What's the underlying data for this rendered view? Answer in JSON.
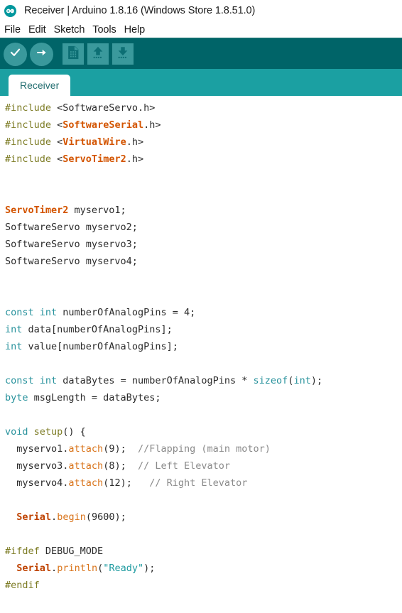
{
  "window": {
    "logo_icon": "arduino-infinity-icon",
    "title": "Receiver | Arduino 1.8.16 (Windows Store 1.8.51.0)"
  },
  "menubar": {
    "items": [
      {
        "label": "File"
      },
      {
        "label": "Edit"
      },
      {
        "label": "Sketch"
      },
      {
        "label": "Tools"
      },
      {
        "label": "Help"
      }
    ]
  },
  "toolbar": {
    "buttons": [
      {
        "name": "verify-button",
        "icon": "checkmark-icon",
        "label": "Verify"
      },
      {
        "name": "upload-button",
        "icon": "right-arrow-icon",
        "label": "Upload"
      },
      {
        "name": "new-button",
        "icon": "new-document-icon",
        "label": "New"
      },
      {
        "name": "open-button",
        "icon": "up-arrow-icon",
        "label": "Open"
      },
      {
        "name": "save-button",
        "icon": "down-arrow-icon",
        "label": "Save"
      }
    ]
  },
  "tabs": [
    {
      "label": "Receiver",
      "active": true
    }
  ],
  "colors": {
    "toolbar_bg": "#006468",
    "tabbar_bg": "#1ba0a2",
    "tab_button_bg": "#3a999c",
    "tab_text": "#236e70",
    "editor_bg": "#ffffff",
    "preprocessor": "#7d7c25",
    "keyword": "#28929c",
    "library": "#d35400",
    "object": "#bf4302",
    "method": "#d9741b",
    "string": "#1f9ba0",
    "comment": "#8a8a8a",
    "plain_text": "#2b2b2b"
  },
  "editor": {
    "lines": [
      [
        {
          "t": "#include ",
          "c": "t-pre"
        },
        {
          "t": "<SoftwareServo.h>",
          "c": "t-plain"
        }
      ],
      [
        {
          "t": "#include ",
          "c": "t-pre"
        },
        {
          "t": "<",
          "c": "t-plain"
        },
        {
          "t": "SoftwareSerial",
          "c": "t-lib"
        },
        {
          "t": ".h>",
          "c": "t-plain"
        }
      ],
      [
        {
          "t": "#include ",
          "c": "t-pre"
        },
        {
          "t": "<",
          "c": "t-plain"
        },
        {
          "t": "VirtualWire",
          "c": "t-lib"
        },
        {
          "t": ".h>",
          "c": "t-plain"
        }
      ],
      [
        {
          "t": "#include ",
          "c": "t-pre"
        },
        {
          "t": "<",
          "c": "t-plain"
        },
        {
          "t": "ServoTimer2",
          "c": "t-lib"
        },
        {
          "t": ".h>",
          "c": "t-plain"
        }
      ],
      [],
      [],
      [
        {
          "t": "ServoTimer2",
          "c": "t-lib"
        },
        {
          "t": " myservo1;",
          "c": "t-plain"
        }
      ],
      [
        {
          "t": "SoftwareServo myservo2;",
          "c": "t-plain"
        }
      ],
      [
        {
          "t": "SoftwareServo myservo3;",
          "c": "t-plain"
        }
      ],
      [
        {
          "t": "SoftwareServo myservo4;",
          "c": "t-plain"
        }
      ],
      [],
      [],
      [
        {
          "t": "const",
          "c": "t-kw"
        },
        {
          "t": " ",
          "c": "t-plain"
        },
        {
          "t": "int",
          "c": "t-kw"
        },
        {
          "t": " numberOfAnalogPins = 4;",
          "c": "t-plain"
        }
      ],
      [
        {
          "t": "int",
          "c": "t-kw"
        },
        {
          "t": " data[numberOfAnalogPins];",
          "c": "t-plain"
        }
      ],
      [
        {
          "t": "int",
          "c": "t-kw"
        },
        {
          "t": " value[numberOfAnalogPins];",
          "c": "t-plain"
        }
      ],
      [],
      [
        {
          "t": "const",
          "c": "t-kw"
        },
        {
          "t": " ",
          "c": "t-plain"
        },
        {
          "t": "int",
          "c": "t-kw"
        },
        {
          "t": " dataBytes = numberOfAnalogPins * ",
          "c": "t-plain"
        },
        {
          "t": "sizeof",
          "c": "t-kw"
        },
        {
          "t": "(",
          "c": "t-plain"
        },
        {
          "t": "int",
          "c": "t-kw"
        },
        {
          "t": ");",
          "c": "t-plain"
        }
      ],
      [
        {
          "t": "byte",
          "c": "t-kw"
        },
        {
          "t": " msgLength = dataBytes;",
          "c": "t-plain"
        }
      ],
      [],
      [
        {
          "t": "void",
          "c": "t-kw"
        },
        {
          "t": " ",
          "c": "t-plain"
        },
        {
          "t": "setup",
          "c": "t-func"
        },
        {
          "t": "() {",
          "c": "t-plain"
        }
      ],
      [
        {
          "t": "  myservo1.",
          "c": "t-plain"
        },
        {
          "t": "attach",
          "c": "t-method"
        },
        {
          "t": "(9);  ",
          "c": "t-plain"
        },
        {
          "t": "//Flapping (main motor)",
          "c": "t-comment"
        }
      ],
      [
        {
          "t": "  myservo3.",
          "c": "t-plain"
        },
        {
          "t": "attach",
          "c": "t-method"
        },
        {
          "t": "(8);  ",
          "c": "t-plain"
        },
        {
          "t": "// Left Elevator",
          "c": "t-comment"
        }
      ],
      [
        {
          "t": "  myservo4.",
          "c": "t-plain"
        },
        {
          "t": "attach",
          "c": "t-method"
        },
        {
          "t": "(12);   ",
          "c": "t-plain"
        },
        {
          "t": "// Right Elevator",
          "c": "t-comment"
        }
      ],
      [],
      [
        {
          "t": "  ",
          "c": "t-plain"
        },
        {
          "t": "Serial",
          "c": "t-obj"
        },
        {
          "t": ".",
          "c": "t-plain"
        },
        {
          "t": "begin",
          "c": "t-method"
        },
        {
          "t": "(9600);",
          "c": "t-plain"
        }
      ],
      [],
      [
        {
          "t": "#ifdef",
          "c": "t-pre"
        },
        {
          "t": " DEBUG_MODE",
          "c": "t-plain"
        }
      ],
      [
        {
          "t": "  ",
          "c": "t-plain"
        },
        {
          "t": "Serial",
          "c": "t-obj"
        },
        {
          "t": ".",
          "c": "t-plain"
        },
        {
          "t": "println",
          "c": "t-method"
        },
        {
          "t": "(",
          "c": "t-plain"
        },
        {
          "t": "\"Ready\"",
          "c": "t-str"
        },
        {
          "t": ");",
          "c": "t-plain"
        }
      ],
      [
        {
          "t": "#endif",
          "c": "t-pre"
        }
      ]
    ]
  }
}
